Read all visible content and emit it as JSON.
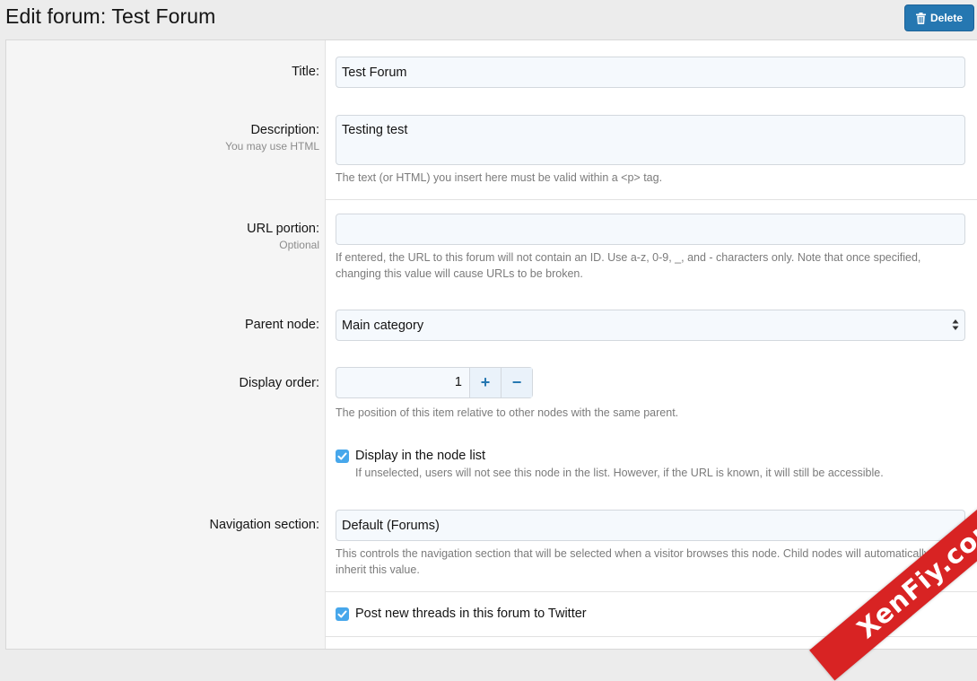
{
  "header": {
    "title": "Edit forum: Test Forum",
    "delete_label": "Delete"
  },
  "fields": {
    "title": {
      "label": "Title:",
      "value": "Test Forum"
    },
    "description": {
      "label": "Description:",
      "hint": "You may use HTML",
      "value": "Testing test",
      "explain": "The text (or HTML) you insert here must be valid within a <p> tag."
    },
    "url_portion": {
      "label": "URL portion:",
      "hint": "Optional",
      "value": "",
      "explain_line1": "If entered, the URL to this forum will not contain an ID. Use a-z, 0-9, _, and - characters only. Note that once specified,",
      "explain_line2": "changing this value will cause URLs to be broken."
    },
    "parent_node": {
      "label": "Parent node:",
      "value": "Main category"
    },
    "display_order": {
      "label": "Display order:",
      "value": "1",
      "plus": "+",
      "minus": "−",
      "explain": "The position of this item relative to other nodes with the same parent."
    },
    "display_in_list": {
      "label": "Display in the node list",
      "checked": true,
      "hint": "If unselected, users will not see this node in the list. However, if the URL is known, it will still be accessible."
    },
    "navigation_section": {
      "label": "Navigation section:",
      "value": "Default (Forums)",
      "explain_line1": "This controls the navigation section that will be selected when a visitor browses this node. Child nodes will automatically",
      "explain_line2": "inherit this value."
    },
    "post_to_twitter": {
      "label": "Post new threads in this forum to Twitter",
      "checked": true
    }
  },
  "watermark": {
    "text": "XenFiy.com"
  },
  "colors": {
    "accent": "#2577b1",
    "checkbox": "#47a7eb",
    "ribbon": "#d82323"
  }
}
